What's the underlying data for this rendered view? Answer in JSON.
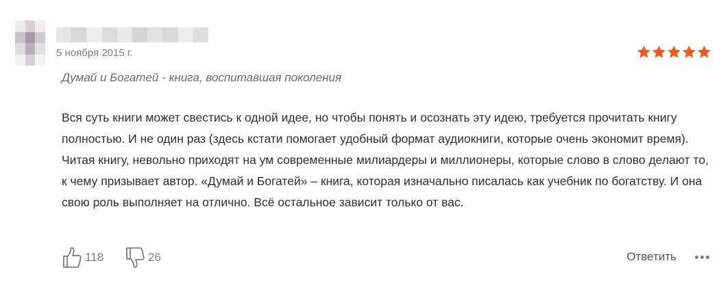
{
  "review": {
    "date": "5 ноября 2015 г.",
    "rating": 5,
    "rating_max": 5,
    "title": "Думай и Богатей - книга, воспитавшая поколения",
    "text": "Вся суть книги может свестись к одной идее, но чтобы понять и осознать эту идею, требуется прочитать книгу полностью. И не один раз (здесь кстати помогает удобный формат аудиокниги, которые очень экономит время). Читая книгу, невольно приходят на ум современные милиардеры и миллионеры, которые слово в слово делают то, к чему призывает автор. «Думай и Богатей» – книга, которая изначально писалась как учебник по богатству. И она свою роль выполняет на отлично. Всё остальное зависит только от вас.",
    "likes": "118",
    "dislikes": "26",
    "reply_label": "Ответить"
  },
  "icons": {
    "avatar": "blurred-avatar",
    "username": "blurred-username",
    "star": "star-icon",
    "like": "thumbs-up-icon",
    "dislike": "thumbs-down-icon",
    "more": "more-dots-icon"
  },
  "colors": {
    "star": "#f05a22",
    "date": "#7b7b7b",
    "title": "#6b6b6b",
    "text": "#2f2f2f",
    "meta": "#7b7b7b"
  }
}
